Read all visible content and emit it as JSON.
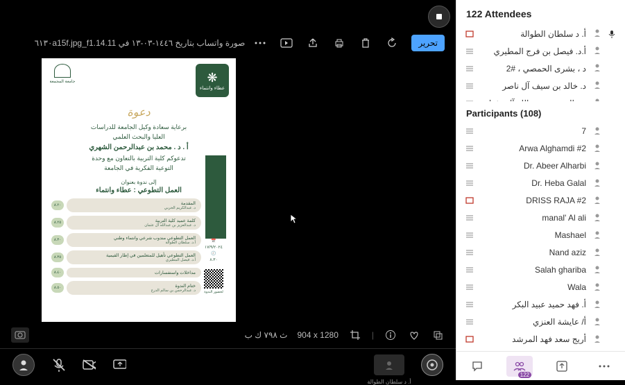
{
  "toolbar": {
    "file_name": "صورة واتساب بتاريخ ١٤٤٦-٠٣-١٣ في ٦١٣٠a15f.jpg_f1.14.11",
    "edit_label": "تحرير"
  },
  "poster": {
    "logo_right_label": "عطاء وانتماء",
    "logo_left_label": "جامعة المجمعة",
    "invite_word": "دعوة",
    "line1": "برعاية سعادة وكيل الجامعة للدراسات",
    "line2": "العليا والبحث العلمي",
    "name_bold": "أ . د . محمد بن عبدالرحمن الشهري",
    "line3": "تدعوكم كلية التربية بالتعاون مع وحدة",
    "line4": "التوعية الفكرية في الجامعة",
    "subtitle_lead": "إلى ندوة بعنوان",
    "title_main": "العمل التطوعي : عطاء وانتماء",
    "qr_label": "لحضور الندوة",
    "agenda": [
      {
        "text_line1": "المقدمة",
        "text_line2": "د. عبدالكريم الحربي",
        "time": "٨.٢٠"
      },
      {
        "text_line1": "كلمة عميد كلية التربية",
        "text_line2": "د. عبدالعزيز بن عبدالله آل عثمان",
        "time": "٨.٢٥"
      },
      {
        "text_line1": "العمل التطوعي مندوب شرعي وانتماء وطني",
        "text_line2": "أ.د. سلطان الطوالة",
        "time": "٨.٣٠"
      },
      {
        "text_line1": "العمل التطوعي تأهيل للمتعلمين في إطار القيمية",
        "text_line2": "أ.د. فيصل المطيري",
        "time": "٨.٣٥"
      },
      {
        "text_line1": "مداخلات واستفسارات",
        "text_line2": "",
        "time": "٨.٤٠"
      },
      {
        "text_line1": "ختام الندوة",
        "text_line2": "د. عبدالرحمن بن سالم الدرع",
        "time": "٨.٥٠"
      }
    ],
    "date_meta": "١٧/٩/٢٠٢٤",
    "time_meta": "٨.٣٠"
  },
  "bottom_meta": {
    "size": "ث ٧٩٨ ك ب",
    "dims": "904 x 1280"
  },
  "sidebar": {
    "header": "122 Attendees",
    "speakers": [
      {
        "name": "أ. د سلطان الطوالة",
        "mic": true,
        "marker": "red"
      },
      {
        "name": "أ.د. فيصل بن فرج المطيري",
        "marker": "grey"
      },
      {
        "name": "د ، بشرى الحمصي ، #2",
        "marker": "grey"
      },
      {
        "name": "د. خالد بن سيف آل ناصر",
        "marker": "grey"
      },
      {
        "name": "عبدالعزيز بن عبدالله آل عثمان",
        "marker": "grey"
      }
    ],
    "participants_label": "Participants (108)",
    "participants": [
      {
        "name": "7",
        "marker": "grey"
      },
      {
        "name": "Arwa Alghamdi #2",
        "marker": "grey"
      },
      {
        "name": "Dr. Abeer Alharbi",
        "marker": "grey"
      },
      {
        "name": "Dr. Heba Galal",
        "marker": "grey"
      },
      {
        "name": "DRISS RAJA #2",
        "marker": "red"
      },
      {
        "name": "manal' Al ali",
        "marker": "grey"
      },
      {
        "name": "Mashael",
        "marker": "grey"
      },
      {
        "name": "Nand aziz",
        "marker": "grey"
      },
      {
        "name": "Salah ghariba",
        "marker": "grey"
      },
      {
        "name": "Wala",
        "marker": "grey"
      },
      {
        "name": "أ. فهد حميد عبيد البكر",
        "marker": "grey"
      },
      {
        "name": "أ/ عايشة العنزي",
        "marker": "grey"
      },
      {
        "name": "أريج سعد فهد المرشد",
        "marker": "red"
      }
    ],
    "mini_label": "أ. د سلطان الطوالة",
    "tab_badge": "122"
  }
}
